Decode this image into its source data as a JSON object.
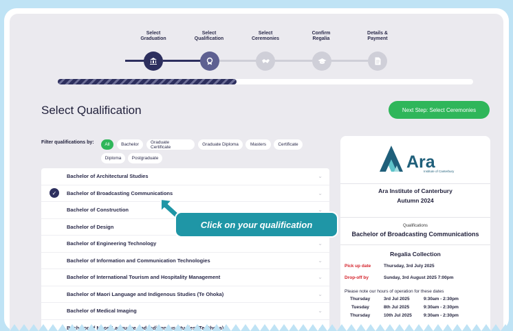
{
  "stepper": {
    "steps": [
      {
        "label_line1": "Select",
        "label_line2": "Graduation",
        "icon": "bank-icon"
      },
      {
        "label_line1": "Select",
        "label_line2": "Qualification",
        "icon": "award-icon"
      },
      {
        "label_line1": "Select",
        "label_line2": "Ceremonies",
        "icon": "handshake-icon"
      },
      {
        "label_line1": "Confirm",
        "label_line2": "Regalia",
        "icon": "mortarboard-icon"
      },
      {
        "label_line1": "Details &",
        "label_line2": "Payment",
        "icon": "document-icon"
      }
    ],
    "progress_fraction": 0.43,
    "colors": {
      "done": "#2d2f5e",
      "current": "#5e6091",
      "todo": "#cfcfd8"
    }
  },
  "page": {
    "title": "Select Qualification",
    "next_button": "Next Step: Select Ceremonies"
  },
  "filters": {
    "label": "Filter qualifications by:",
    "chips": [
      "All",
      "Bachelor",
      "Graduate Certificate",
      "Graduate Diploma",
      "Masters",
      "Certificate",
      "Diploma",
      "Postgraduate"
    ],
    "active": "All"
  },
  "qualifications": [
    {
      "name": "Bachelor of Architectural Studies",
      "selected": false
    },
    {
      "name": "Bachelor of Broadcasting Communications",
      "selected": true
    },
    {
      "name": "Bachelor of Construction",
      "selected": false
    },
    {
      "name": "Bachelor of Design",
      "selected": false
    },
    {
      "name": "Bachelor of Engineering Technology",
      "selected": false
    },
    {
      "name": "Bachelor of Information and Communication Technologies",
      "selected": false
    },
    {
      "name": "Bachelor of International Tourism and Hospitality Management",
      "selected": false
    },
    {
      "name": "Bachelor of Maori Language and Indigenous Studies (Te Ohoka)",
      "selected": false
    },
    {
      "name": "Bachelor of Medical Imaging",
      "selected": false
    },
    {
      "name": "Bachelor of Maori Language and Indigenous Studies (Te Ohoka)",
      "selected": false
    }
  ],
  "callout": "Click on your qualification",
  "panel": {
    "logo_text": "Ara",
    "logo_subtext": "Institute of Canterbury",
    "institution": "Ara Institute of Canterbury",
    "term": "Autumn 2024",
    "qual_label": "Qualifications",
    "qual_value": "Bachelor of Broadcasting Communications",
    "regalia_title": "Regalia Collection",
    "pickup_label": "Pick up date",
    "pickup_value": "Thursday, 3rd July 2025",
    "dropoff_label": "Drop-off by",
    "dropoff_value": "Sunday, 3rd August 2025 7:00pm",
    "hours_note": "Please note our hours of operation for these dates",
    "hours": [
      {
        "day": "Thursday",
        "date": "3rd Jul 2025",
        "time": "9:30am - 2:30pm"
      },
      {
        "day": "Tuesday",
        "date": "8th Jul 2025",
        "time": "9:30am - 2:30pm"
      },
      {
        "day": "Thursday",
        "date": "10th Jul 2025",
        "time": "9:30am - 2:30pm"
      }
    ]
  }
}
